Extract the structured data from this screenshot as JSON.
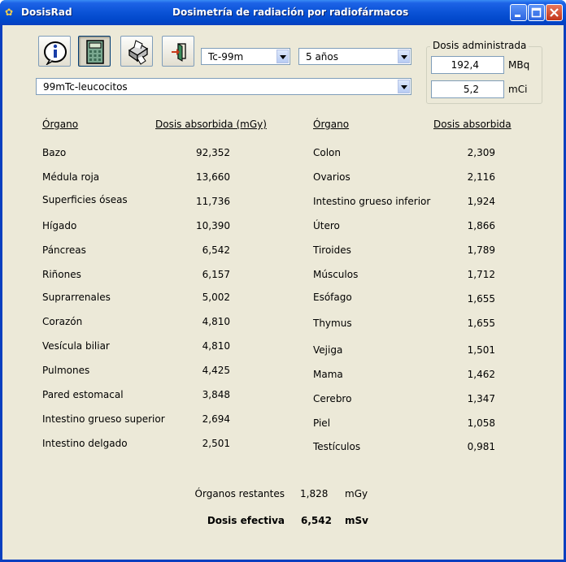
{
  "window": {
    "app_name": "DosisRad",
    "title": "Dosimetría de radiación por radiofármacos"
  },
  "toolbar": {
    "icons": [
      "info-icon",
      "calculator-icon",
      "printer-icon",
      "exit-icon"
    ]
  },
  "isotope_select": "Tc-99m",
  "age_select": "5 años",
  "compound_select": "99mTc-leucocitos",
  "dose_box": {
    "title": "Dosis administrada",
    "mbq_value": "192,4",
    "mbq_unit": "MBq",
    "mci_value": "5,2",
    "mci_unit": "mCi"
  },
  "table_left": {
    "col_organ": "Órgano",
    "col_dose": "Dosis absorbida (mGy)",
    "rows": [
      {
        "organ": "Bazo",
        "dose": "92,352"
      },
      {
        "organ": "Médula roja",
        "dose": "13,660"
      },
      {
        "organ": "Superficies óseas",
        "dose": "11,736"
      },
      {
        "organ": "Hígado",
        "dose": "10,390"
      },
      {
        "organ": "Páncreas",
        "dose": "6,542"
      },
      {
        "organ": "Riñones",
        "dose": "6,157"
      },
      {
        "organ": "Suprarrenales",
        "dose": "5,002"
      },
      {
        "organ": "Corazón",
        "dose": "4,810"
      },
      {
        "organ": "Vesícula biliar",
        "dose": "4,810"
      },
      {
        "organ": "Pulmones",
        "dose": "4,425"
      },
      {
        "organ": "Pared estomacal",
        "dose": "3,848"
      },
      {
        "organ": "Intestino grueso superior",
        "dose": "2,694"
      },
      {
        "organ": "Intestino delgado",
        "dose": "2,501"
      }
    ]
  },
  "table_right": {
    "col_organ": "Órgano",
    "col_dose": "Dosis absorbida",
    "rows": [
      {
        "organ": "Colon",
        "dose": "2,309"
      },
      {
        "organ": "Ovarios",
        "dose": "2,116"
      },
      {
        "organ": "Intestino grueso inferior",
        "dose": "1,924"
      },
      {
        "organ": "Útero",
        "dose": "1,866"
      },
      {
        "organ": "Tiroides",
        "dose": "1,789"
      },
      {
        "organ": "Músculos",
        "dose": "1,712"
      },
      {
        "organ": "Esófago",
        "dose": "1,655"
      },
      {
        "organ": "Thymus",
        "dose": "1,655"
      },
      {
        "organ": "Vejiga",
        "dose": "1,501"
      },
      {
        "organ": "Mama",
        "dose": "1,462"
      },
      {
        "organ": "Cerebro",
        "dose": "1,347"
      },
      {
        "organ": "Piel",
        "dose": "1,058"
      },
      {
        "organ": "Testículos",
        "dose": "0,981"
      }
    ]
  },
  "summary": {
    "remaining_label": "Órganos restantes",
    "remaining_value": "1,828",
    "remaining_unit": "mGy",
    "effective_label": "Dosis efectiva",
    "effective_value": "6,542",
    "effective_unit": "mSv"
  }
}
